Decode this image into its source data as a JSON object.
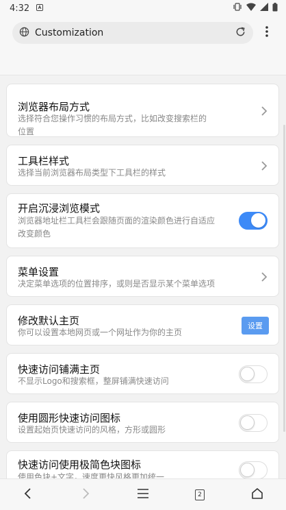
{
  "status_bar": {
    "time": "4:32"
  },
  "toolbar": {
    "url_title": "Customization"
  },
  "settings": [
    {
      "title": "浏览器布局方式",
      "description_lines": [
        "选择符合您操作习惯的布局方式，比如改变搜索栏的",
        "位置"
      ],
      "control": "chevron"
    },
    {
      "title": "工具栏样式",
      "description_lines": [
        "选择当前浏览器布局类型下工具栏的样式"
      ],
      "control": "chevron"
    },
    {
      "title": "开启沉浸浏览模式",
      "description_lines": [
        "浏览器地址栏工具栏会跟随页面的渲染颜色进行自适应",
        "改变颜色"
      ],
      "control": "toggle",
      "enabled": true
    },
    {
      "title": "菜单设置",
      "description_lines": [
        "决定菜单选项的位置排序，或则是否显示某个菜单选项"
      ],
      "control": "chevron"
    },
    {
      "title": "修改默认主页",
      "description_lines": [
        "你可以设置本地网页或一个网址作为你的主页"
      ],
      "control": "button",
      "button_label": "设置"
    },
    {
      "title": "快速访问铺满主页",
      "description_lines": [
        "不显示Logo和搜索框，整屏铺满快速访问"
      ],
      "control": "toggle",
      "enabled": false
    },
    {
      "title": "使用圆形快速访问图标",
      "description_lines": [
        "设置起始页快速访问的风格，方形或圆形"
      ],
      "control": "toggle",
      "enabled": false
    },
    {
      "title": "快速访问使用极简色块图标",
      "description_lines": [
        "使用色块+文字，速度更快风格更加统一"
      ],
      "control": "toggle",
      "enabled": false
    }
  ],
  "nav_bar": {
    "tab_count": "2"
  },
  "colors": {
    "accent": "#3d8af7",
    "button": "#5a9bf0"
  }
}
